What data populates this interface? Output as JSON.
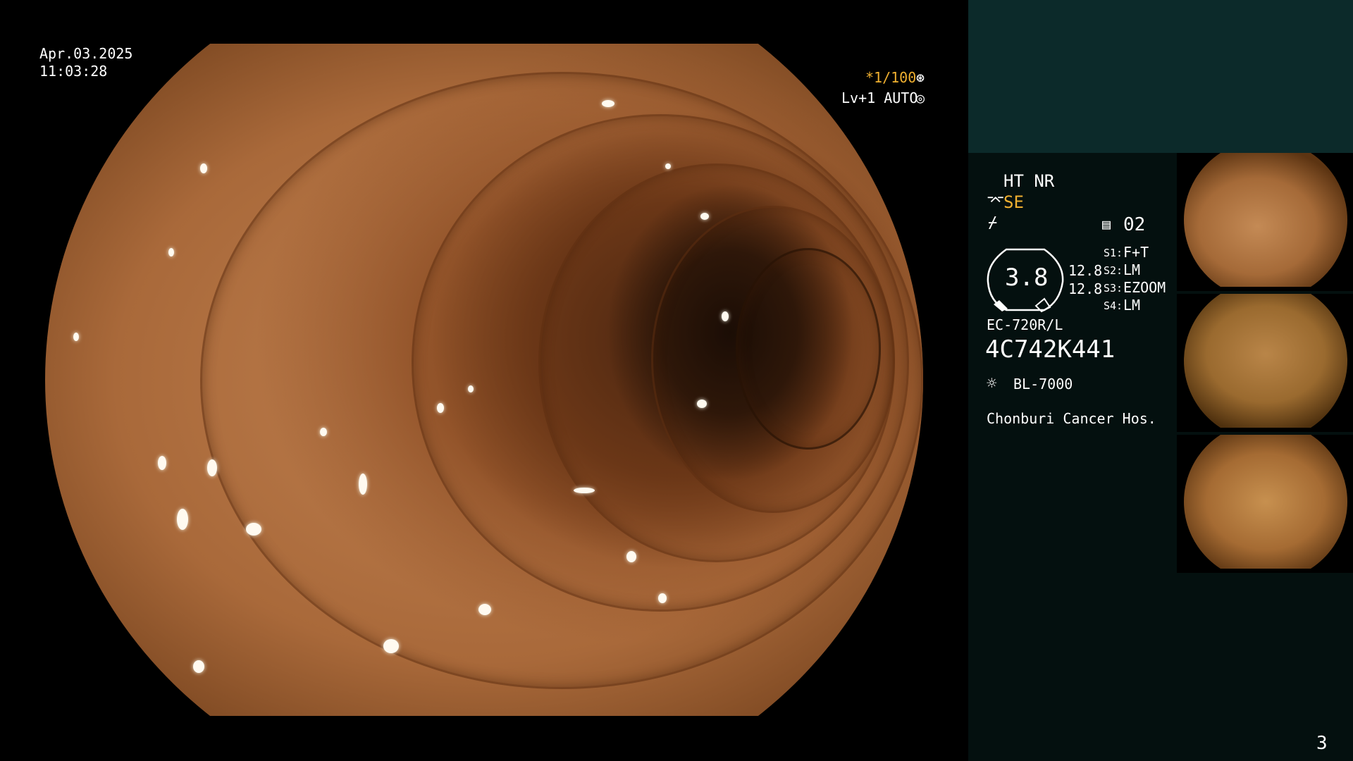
{
  "osd": {
    "date": "Apr.03.2025",
    "time": "11:03:28",
    "shutter": "*1/100",
    "level": "Lv+1 AUTO"
  },
  "panel": {
    "mode": "HT NR",
    "se_label": "SE",
    "channel": "02",
    "gauge_value": "3.8",
    "readout_1": "12.8",
    "readout_2": "12.8",
    "s_settings": [
      {
        "key": "S1:",
        "value": "F+T"
      },
      {
        "key": "S2:",
        "value": "LM"
      },
      {
        "key": "S3:",
        "value": "EZOOM"
      },
      {
        "key": "S4:",
        "value": "LM"
      }
    ],
    "scope_model": "EC-720R/L",
    "serial": "4C742K441",
    "light_source": "BL-7000",
    "hospital": "Chonburi Cancer Hos."
  },
  "page_number": "3",
  "colors": {
    "accent_yellow": "#f0b030",
    "panel_top": "#0c2a2a",
    "panel_bottom": "#04100f"
  },
  "icons": [
    "shutter-icon",
    "auto-icon",
    "scope-icon",
    "flash-icon",
    "record-icon",
    "light-icon"
  ]
}
